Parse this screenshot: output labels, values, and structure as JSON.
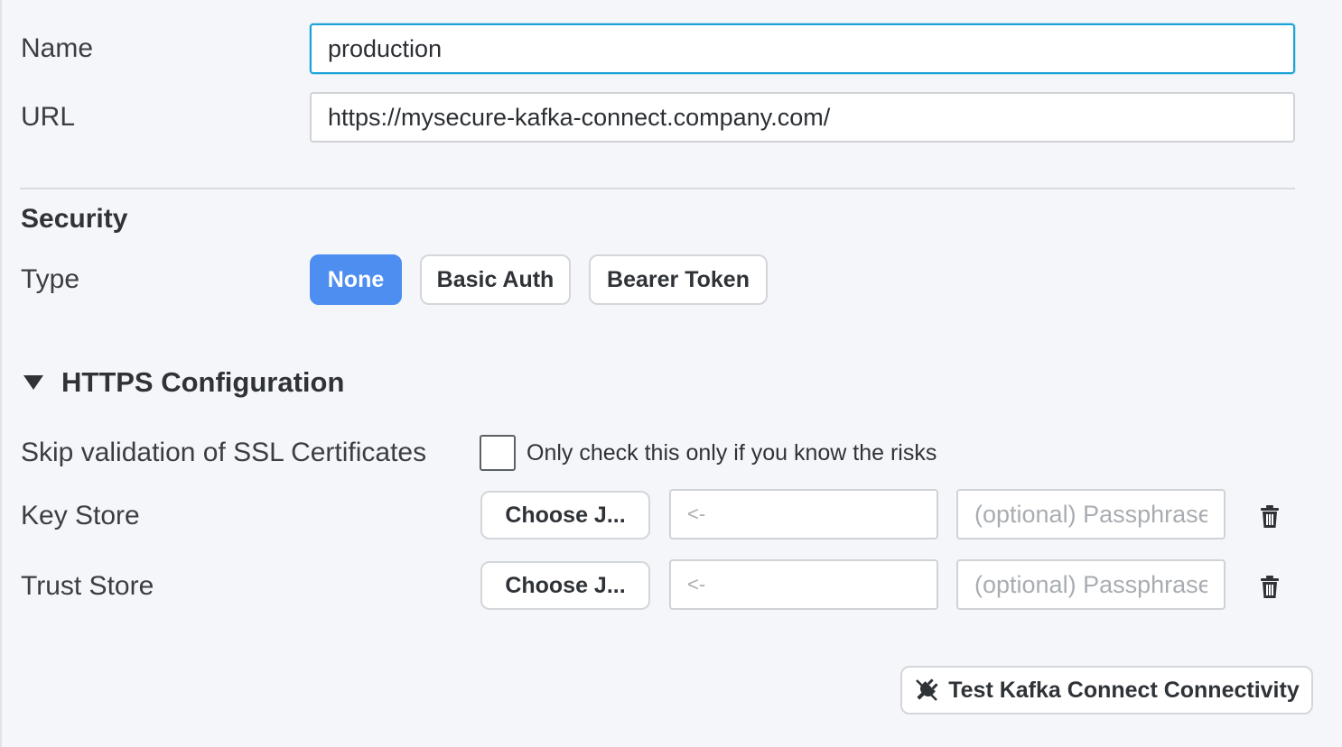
{
  "connection": {
    "name_label": "Name",
    "name_value": "production",
    "url_label": "URL",
    "url_value": "https://mysecure-kafka-connect.company.com/"
  },
  "security": {
    "title": "Security",
    "type_label": "Type",
    "options": [
      "None",
      "Basic Auth",
      "Bearer Token"
    ],
    "selected": "None"
  },
  "https": {
    "title": "HTTPS Configuration",
    "expanded": true,
    "skip_ssl_label": "Skip validation of SSL Certificates",
    "skip_ssl_checked": false,
    "skip_ssl_help": "Only check this only if you know the risks",
    "key_store": {
      "label": "Key Store",
      "choose_label": "Choose J...",
      "file_placeholder": "<-",
      "passphrase_placeholder": "(optional) Passphrase"
    },
    "trust_store": {
      "label": "Trust Store",
      "choose_label": "Choose J...",
      "file_placeholder": "<-",
      "passphrase_placeholder": "(optional) Passphrase"
    }
  },
  "actions": {
    "test_label": "Test Kafka Connect Connectivity"
  },
  "colors": {
    "accent": "#4d8ef0",
    "focus_border": "#1aa3d6"
  },
  "icons": {
    "collapse": "caret-down-icon",
    "delete": "trash-icon",
    "test": "plug-icon"
  }
}
